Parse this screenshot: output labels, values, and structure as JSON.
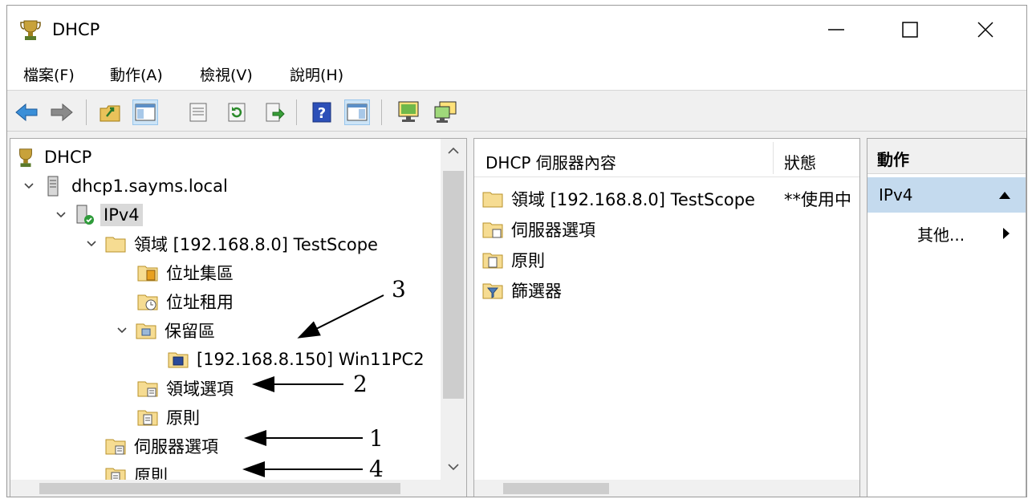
{
  "window": {
    "title": "DHCP",
    "icon": "dhcp-trophy-icon"
  },
  "menu": [
    "檔案(F)",
    "動作(A)",
    "檢視(V)",
    "說明(H)"
  ],
  "toolbar": [
    "back-arrow-icon",
    "forward-arrow-icon",
    "up-folder-icon",
    "show-hide-console-tree-icon",
    "properties-icon",
    "refresh-icon",
    "export-list-icon",
    "help-icon",
    "show-hide-action-pane-icon",
    "server-icon",
    "add-server-icon"
  ],
  "tree": {
    "root": "DHCP",
    "server": "dhcp1.sayms.local",
    "ipv4": "IPv4",
    "scope": "領域 [192.168.8.0] TestScope",
    "address_pool": "位址集區",
    "address_leases": "位址租用",
    "reservations": "保留區",
    "reservation_entry": "[192.168.8.150] Win11PC2",
    "scope_options": "領域選項",
    "scope_policies": "原則",
    "server_options": "伺服器選項",
    "server_policies": "原則"
  },
  "center": {
    "headers": {
      "name": "DHCP 伺服器內容",
      "status": "狀態"
    },
    "rows": [
      {
        "name": "領域 [192.168.8.0] TestScope",
        "status": "**使用中"
      },
      {
        "name": "伺服器選項",
        "status": ""
      },
      {
        "name": "原則",
        "status": ""
      },
      {
        "name": "篩選器",
        "status": ""
      }
    ]
  },
  "actions": {
    "header": "動作",
    "section": "IPv4",
    "item": "其他..."
  },
  "annotations": [
    "3",
    "2",
    "1",
    "4"
  ],
  "colors": {
    "selection": "#c4daee",
    "folder": "#f3d27a",
    "accent_blue": "#2a78c8"
  }
}
